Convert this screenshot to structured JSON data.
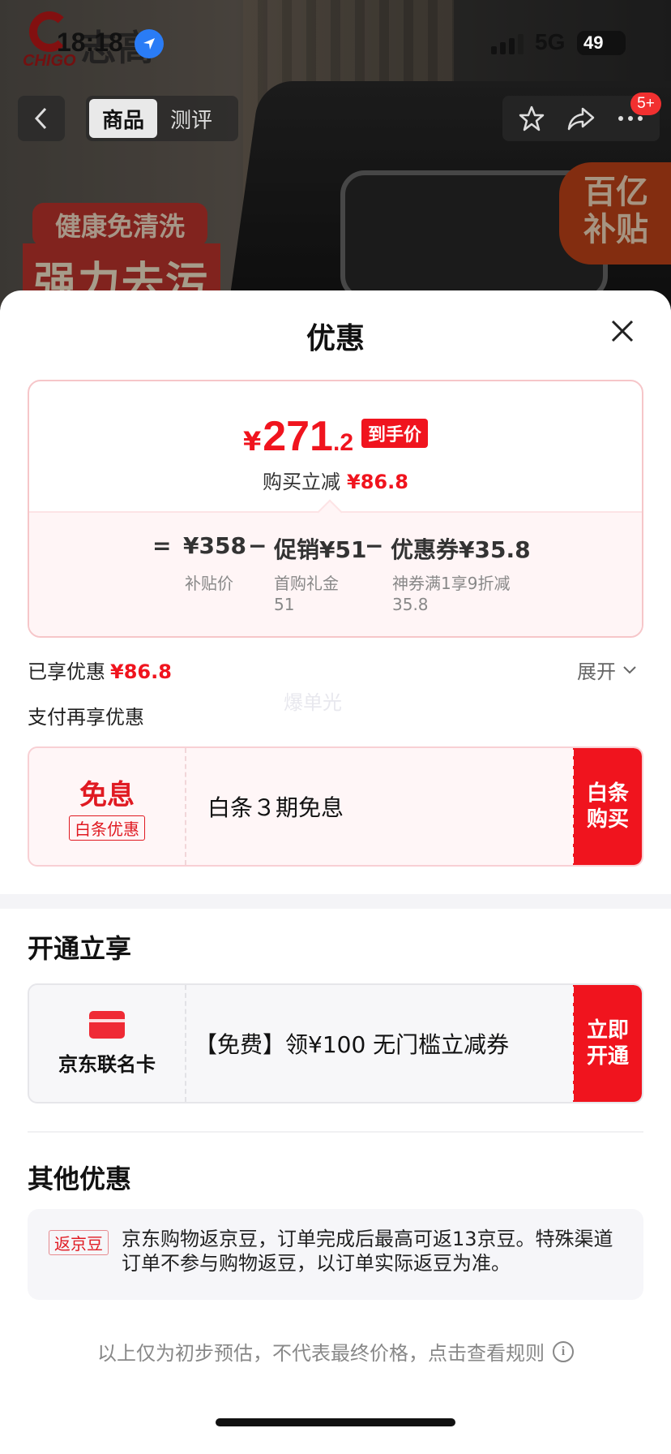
{
  "status_bar": {
    "time": "18:18",
    "network": "5G",
    "battery": "49"
  },
  "hero": {
    "brand_latin": "CHIGO",
    "brand_cn": "志高",
    "tabs": [
      {
        "label": "商品"
      },
      {
        "label": "测评"
      }
    ],
    "cart_badge": "5+",
    "tag_health": "健康免清洗",
    "tag_strong": "强力去污",
    "tag_subsidy_1": "百亿",
    "tag_subsidy_2": "补贴"
  },
  "sheet": {
    "title": "优惠",
    "price": {
      "currency": "¥",
      "integer": "271",
      "decimal": ".2",
      "final_tag": "到手价",
      "reduce_label": "购买立减",
      "reduce_value": "¥86.8",
      "breakdown": {
        "eq": "=",
        "base": "¥358",
        "base_sub": "补贴价",
        "minus": "−",
        "promo": "促销¥51",
        "promo_sub_1": "首购礼金",
        "promo_sub_2": "51",
        "coupon": "优惠券¥35.8",
        "coupon_sub_1": "神券满1享9折减",
        "coupon_sub_2": "35.8"
      }
    },
    "enjoyed_label": "已享优惠",
    "enjoyed_value": "¥86.8",
    "expand_label": "展开",
    "watermark": "爆单光",
    "pay_more_label": "支付再享优惠",
    "baitiao": {
      "title": "免息",
      "tag": "白条优惠",
      "desc": "白条３期免息",
      "button_1": "白条",
      "button_2": "购买"
    },
    "open_section_title": "开通立享",
    "jd_card": {
      "label": "京东联名卡",
      "desc": "【免费】领¥100 无门槛立减券",
      "button_1": "立即",
      "button_2": "开通"
    },
    "other_section_title": "其他优惠",
    "bean": {
      "tag": "返京豆",
      "text": "京东购物返京豆，订单完成后最高可返13京豆。特殊渠道订单不参与购物返豆，以订单实际返豆为准。"
    },
    "footnote": "以上仅为初步预估，不代表最终价格，点击查看规则",
    "accent_color": "#f0141e"
  }
}
